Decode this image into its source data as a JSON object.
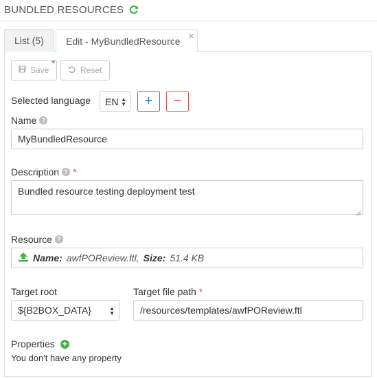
{
  "header": {
    "title": "BUNDLED RESOURCES",
    "refresh_icon": "refresh-icon",
    "refresh_color": "#4cae4c"
  },
  "tabs": [
    {
      "label": "List (5)",
      "active": false
    },
    {
      "label": "Edit - MyBundledResource",
      "active": true,
      "close": "×"
    }
  ],
  "toolbar": {
    "save_label": "Save",
    "save_required_mark": "*",
    "reset_label": "Reset",
    "save_icon": "floppy-disk-icon",
    "reset_icon": "undo-icon"
  },
  "language": {
    "label": "Selected language",
    "value": "EN",
    "add_label": "+",
    "remove_label": "−"
  },
  "name": {
    "label": "Name",
    "value": "MyBundledResource"
  },
  "description": {
    "label": "Description",
    "required_mark": "*",
    "value": "Bundled resource testing deployment test"
  },
  "resource": {
    "label": "Resource",
    "name_key": "Name:",
    "name_value": "awfPOReview.ftl,",
    "size_key": "Size:",
    "size_value": "51.4 KB",
    "upload_icon": "upload-icon"
  },
  "target_root": {
    "label": "Target root",
    "value": "${B2BOX_DATA}"
  },
  "target_path": {
    "label": "Target file path",
    "required_mark": "*",
    "value": "/resources/templates/awfPOReview.ftl"
  },
  "properties": {
    "label": "Properties",
    "empty_text": "You don't have any property"
  },
  "colors": {
    "accent_blue": "#2c7fb8",
    "danger_red": "#d9534f",
    "success_green": "#4cae4c"
  }
}
